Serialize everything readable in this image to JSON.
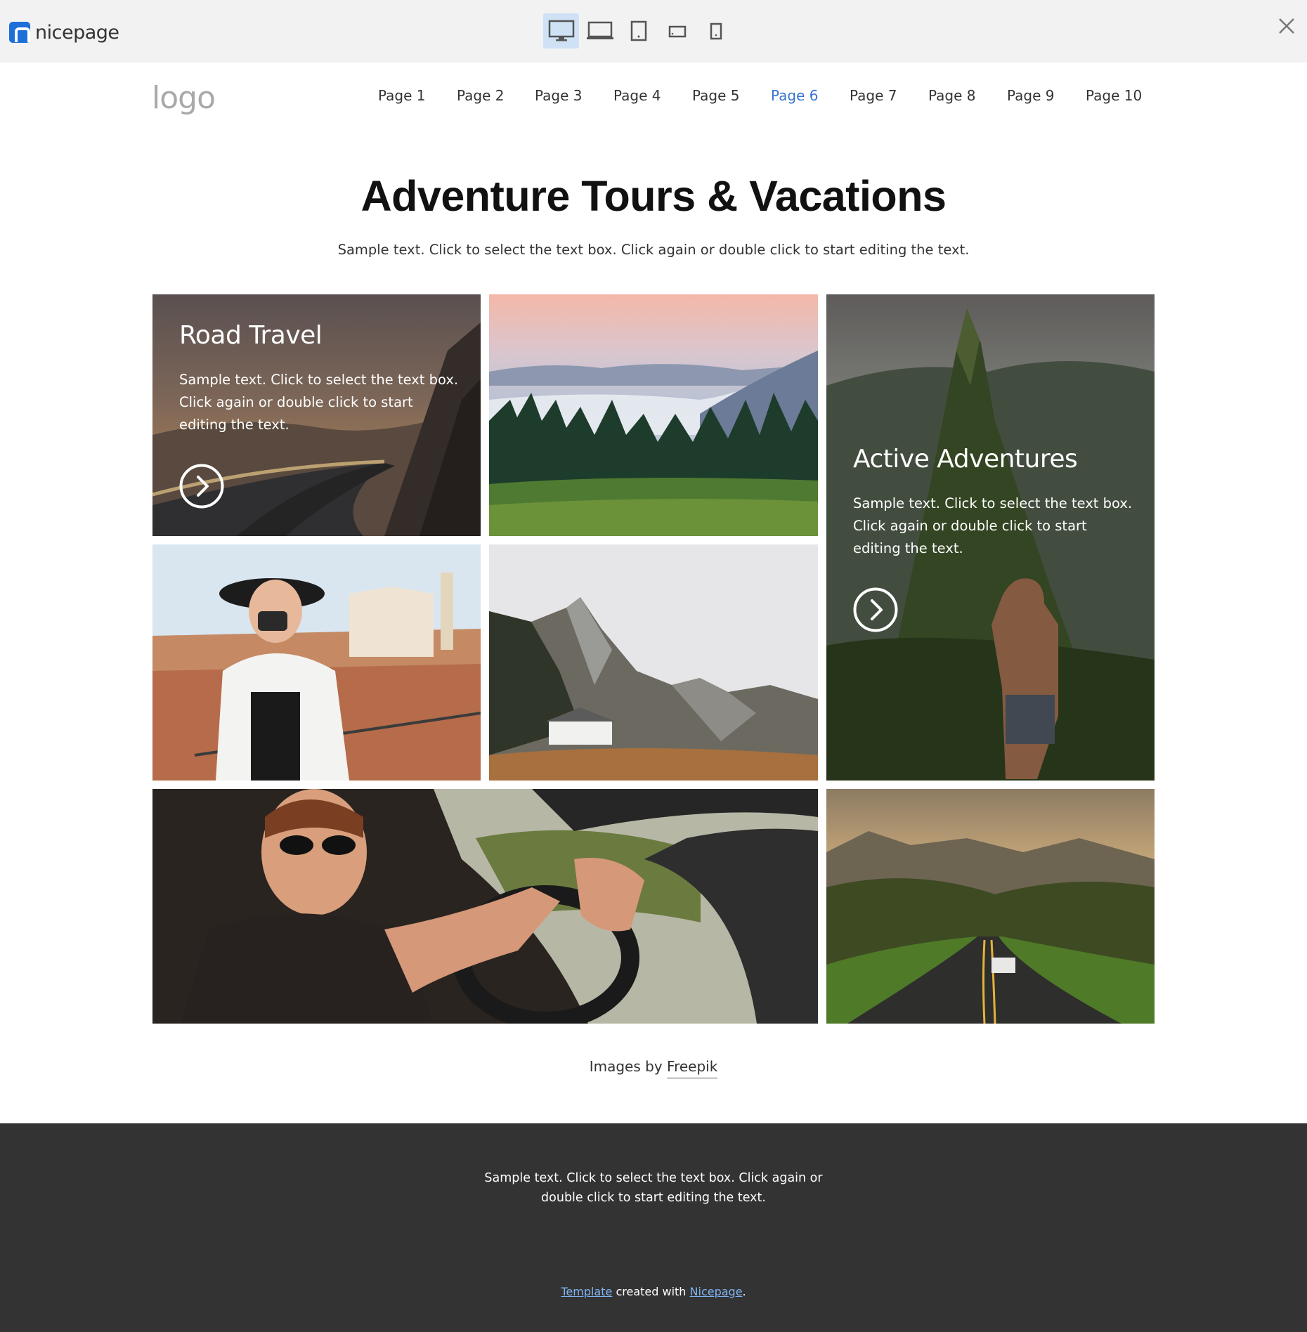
{
  "editor": {
    "brand": "nicepage",
    "devices": [
      {
        "name": "desktop-icon",
        "active": true
      },
      {
        "name": "laptop-icon",
        "active": false
      },
      {
        "name": "tablet-icon",
        "active": false
      },
      {
        "name": "phone-landscape-icon",
        "active": false
      },
      {
        "name": "phone-portrait-icon",
        "active": false
      }
    ],
    "close_icon": "close-icon"
  },
  "header": {
    "logo": "logo",
    "nav": [
      "Page 1",
      "Page 2",
      "Page 3",
      "Page 4",
      "Page 5",
      "Page 6",
      "Page 7",
      "Page 8",
      "Page 9",
      "Page 10"
    ],
    "active_index": 5
  },
  "hero": {
    "title": "Adventure Tours & Vacations",
    "subtitle": "Sample text. Click to select the text box. Click again or double click to start editing the text."
  },
  "gallery": {
    "road_travel": {
      "heading": "Road Travel",
      "text": "Sample text. Click to select the text box. Click again or double click to start editing the text."
    },
    "active_adventures": {
      "heading": "Active Adventures",
      "text": "Sample text. Click to select the text box. Click again or double click to start editing the text."
    }
  },
  "credit": {
    "prefix": "Images by",
    "link": "Freepik"
  },
  "footer": {
    "text": "Sample text. Click to select the text box. Click again or double click to start editing the text.",
    "credit_link1": "Template",
    "credit_middle": "created with",
    "credit_link2": "Nicepage",
    "credit_end": "."
  },
  "colors": {
    "accent": "#3874d0",
    "brand": "#1e6fd9",
    "footer_bg": "#333333",
    "topbar_bg": "#f2f2f2"
  }
}
